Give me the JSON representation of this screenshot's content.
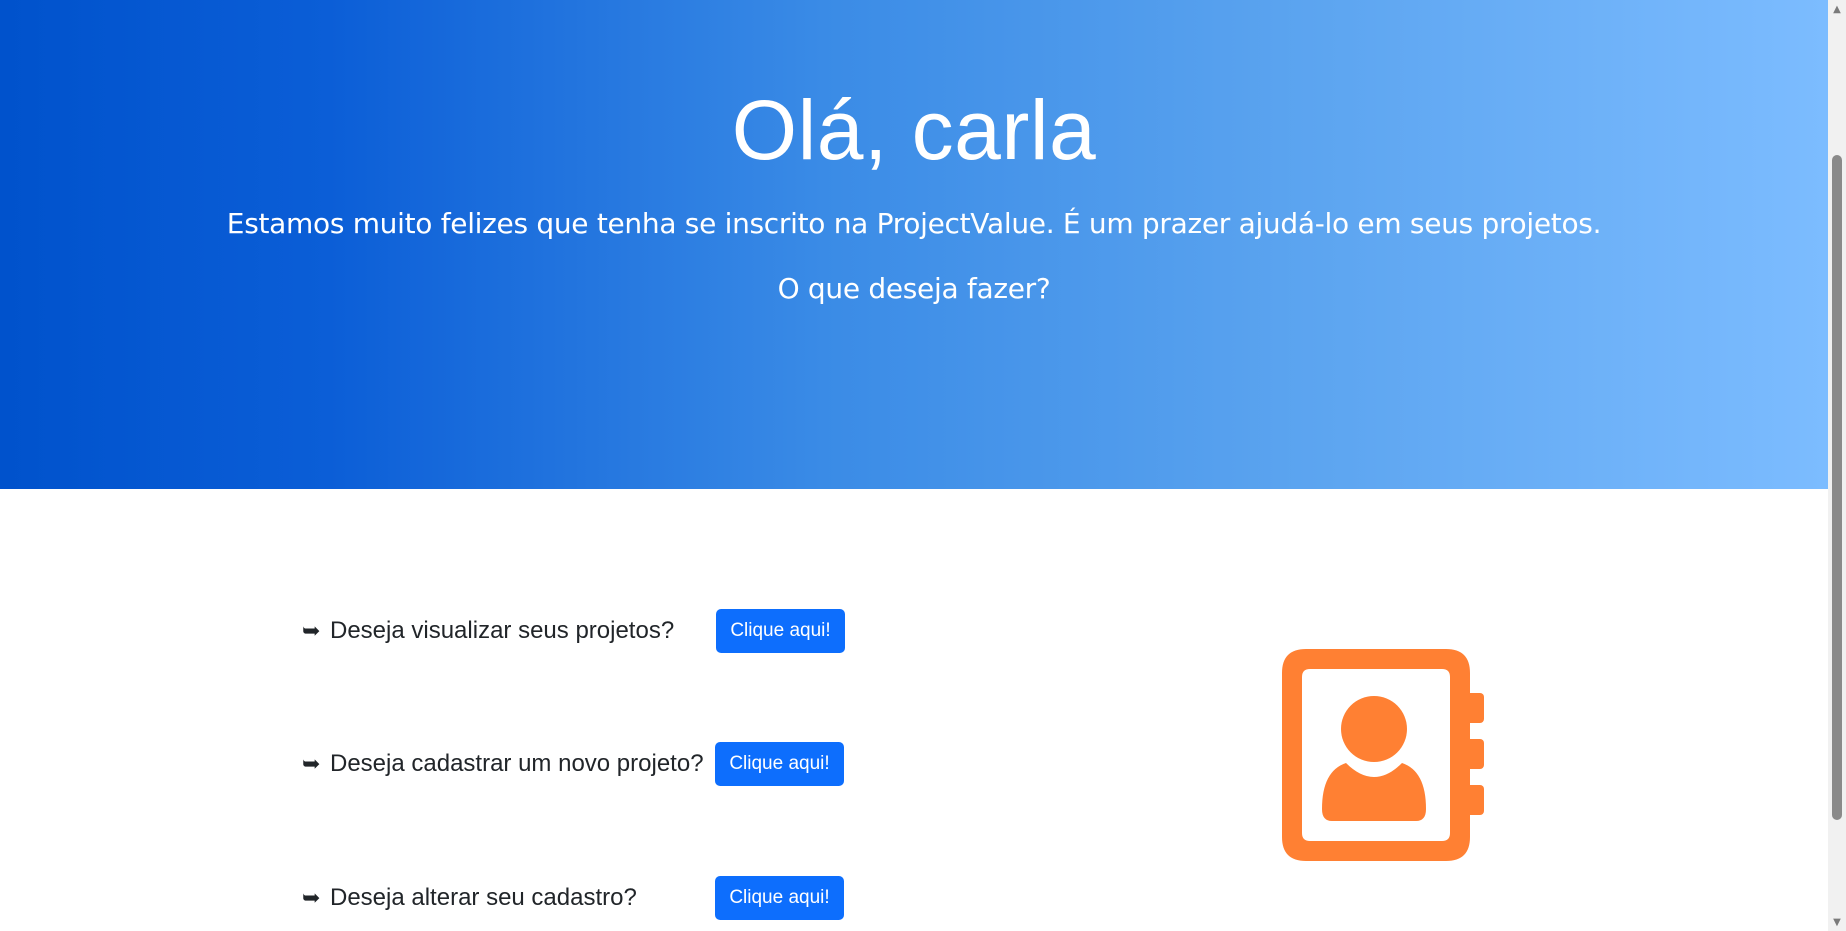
{
  "hero": {
    "title": "Olá, carla",
    "subtitle": "Estamos muito felizes que tenha se inscrito na ProjectValue. É um prazer ajudá-lo em seus projetos.",
    "question": "O que deseja fazer?"
  },
  "options": [
    {
      "arrow": "➥",
      "text": "Deseja visualizar seus projetos?",
      "button_label": "Clique aqui!"
    },
    {
      "arrow": "➥",
      "text": "Deseja cadastrar um novo projeto?",
      "button_label": "Clique aqui!"
    },
    {
      "arrow": "➥",
      "text": "Deseja alterar seu cadastro?",
      "button_label": "Clique aqui!"
    }
  ],
  "illustration": {
    "icon": "address-book-icon",
    "color": "#ff8033"
  },
  "colors": {
    "hero_gradient_start": "#0052cc",
    "hero_gradient_end": "#7cbcff",
    "button": "#0d6efd",
    "text": "#212529"
  }
}
